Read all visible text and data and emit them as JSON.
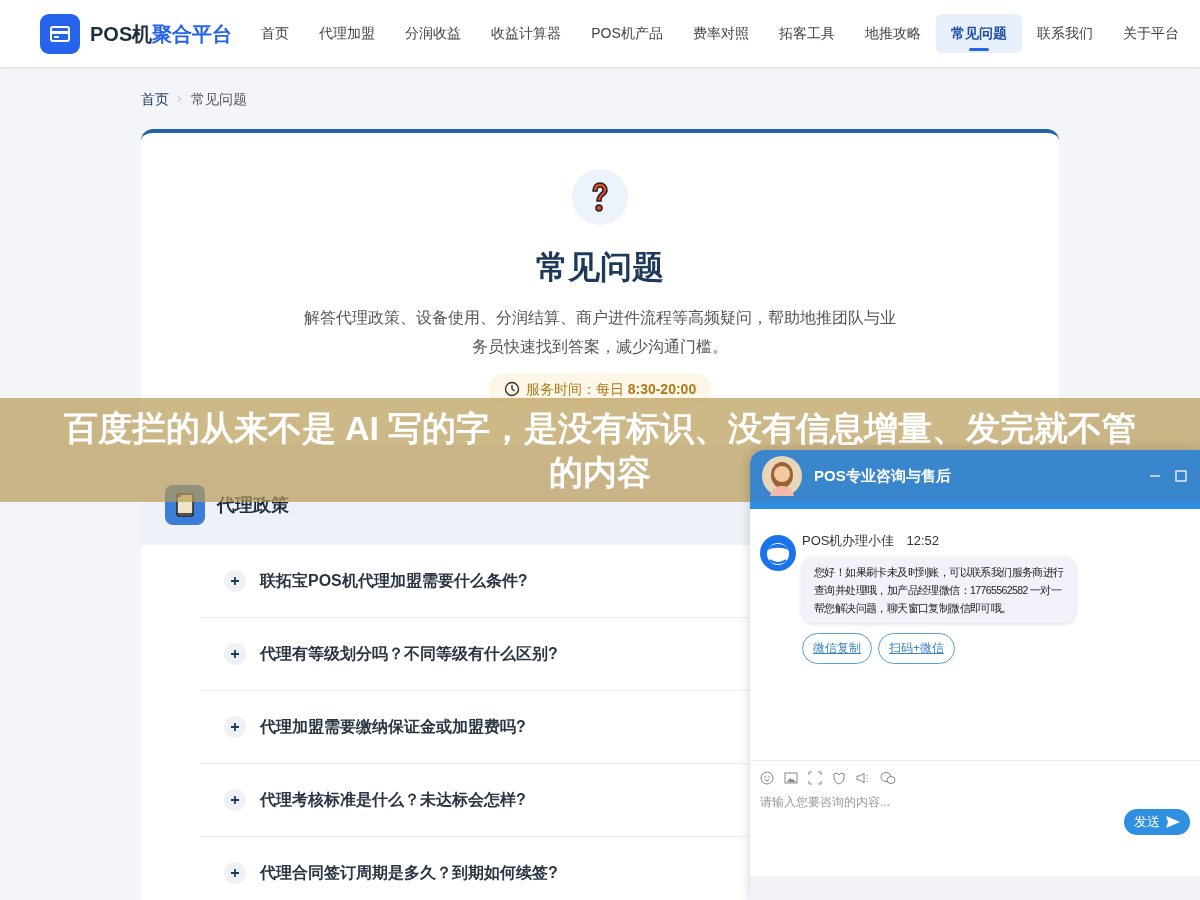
{
  "nav": {
    "logo_prefix": "POS机",
    "logo_suffix": "聚合平台",
    "items": [
      {
        "label": "首页",
        "selected": false
      },
      {
        "label": "代理加盟",
        "selected": false
      },
      {
        "label": "分润收益",
        "selected": false
      },
      {
        "label": "收益计算器",
        "selected": false
      },
      {
        "label": "POS机产品",
        "selected": false
      },
      {
        "label": "费率对照",
        "selected": false
      },
      {
        "label": "拓客工具",
        "selected": false
      },
      {
        "label": "地推攻略",
        "selected": false
      },
      {
        "label": "常见问题",
        "selected": true
      },
      {
        "label": "联系我们",
        "selected": false
      },
      {
        "label": "关于平台",
        "selected": false
      }
    ]
  },
  "breadcrumb": [
    "首页",
    "常见问题"
  ],
  "hero": {
    "title": "常见问题",
    "description": "解答代理政策、设备使用、分润结算、商户进件流程等高频疑问，帮助地推团队与业务员快速找到答案，减少沟通门槛。",
    "hours": "服务时间：每日 **8:30-20:00**"
  },
  "section": {
    "title": "代理政策",
    "questions": [
      {
        "text": "联拓宝POS机代理加盟需要什么条件?",
        "expanded": false
      },
      {
        "text": "代理有等级划分吗？不同等级有什么区别?",
        "expanded": false
      },
      {
        "text": "代理加盟需要缴纳保证金或加盟费吗?",
        "expanded": false
      },
      {
        "text": "代理考核标准是什么？未达标会怎样?",
        "expanded": false
      },
      {
        "text": "代理合同签订周期是多久？到期如何续签?",
        "expanded": false
      }
    ]
  },
  "chat": {
    "title": "POS专业咨询与售后",
    "sender": "POS机办理小佳",
    "time": "12:52",
    "message": "您好！如果刷卡未及时到账，可以联系我们服务商进行查询并处理哦，加产品经理微信：17765562582 一对一帮您解决问题，聊天窗口复制微信即可哦。",
    "quick_replies": [
      "微信复制",
      "扫码+微信"
    ],
    "input": {
      "placeholder": "请输入您要咨询的内容..."
    },
    "send": "发送"
  },
  "banner": {
    "text": "百度拦的从来不是 AI 写的字，是没有标识、没有信息增量、发完就不管的内容"
  }
}
